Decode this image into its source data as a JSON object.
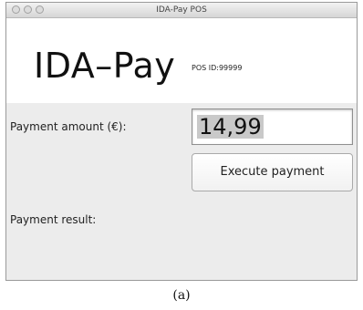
{
  "window": {
    "title": "IDA-Pay POS",
    "buttons": [
      "close",
      "minimize",
      "zoom"
    ]
  },
  "header": {
    "logo": "IDA–Pay",
    "pos_id": "POS ID:99999"
  },
  "form": {
    "amount_label": "Payment amount (€):",
    "amount_value": "14,99",
    "execute_label": "Execute payment",
    "result_label": "Payment result:"
  },
  "caption": "(a)",
  "colors": {
    "window_bg": "#ececec",
    "header_bg": "#ffffff",
    "selection": "#c9c9c9"
  }
}
